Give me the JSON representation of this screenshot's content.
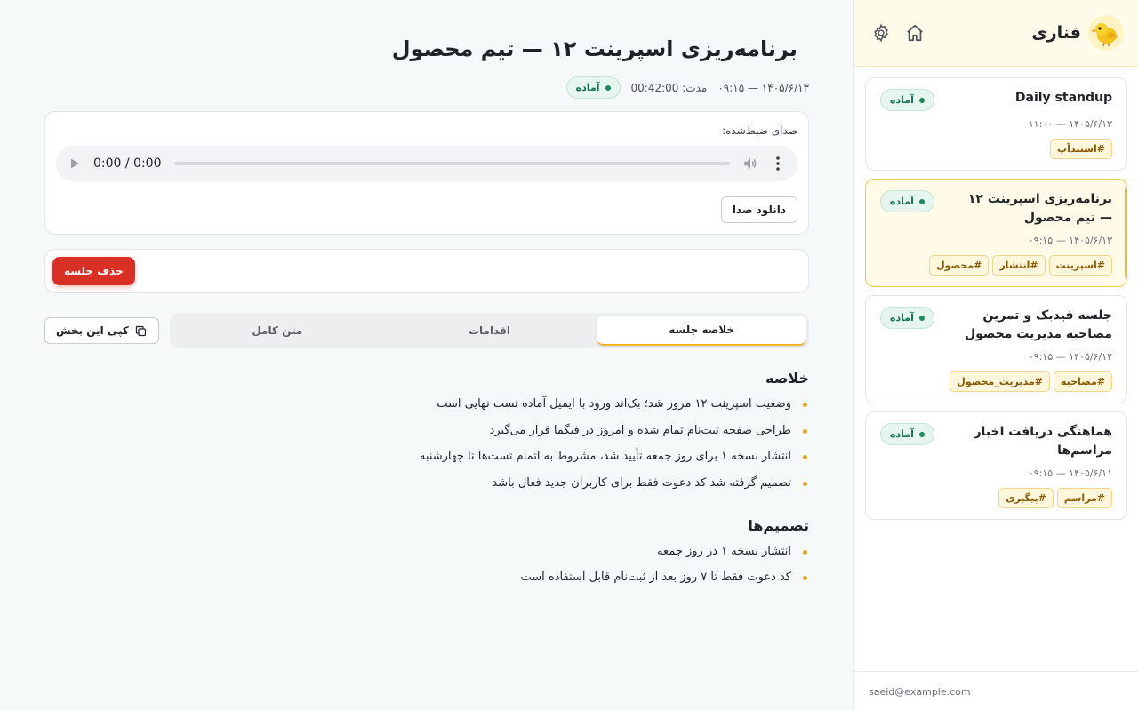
{
  "app": {
    "name": "قناری",
    "user_email": "saeid@example.com"
  },
  "colors": {
    "accent": "#f0b42a",
    "danger": "#d93025",
    "status_ready": "#1a8a5b"
  },
  "icons": {
    "logo": "canary-bird-icon",
    "home": "home-icon",
    "settings": "gear-icon",
    "copy": "copy-icon",
    "play": "play-icon",
    "volume": "volume-icon",
    "more": "more-vertical-icon"
  },
  "meetings": [
    {
      "title": "Daily standup",
      "date": "۱۴۰۵/۶/۱۳ — ۱۱:۰۰",
      "status": "آماده",
      "tags": [
        "#استندآپ"
      ],
      "active": false
    },
    {
      "title": "برنامه‌ریزی اسپرینت ۱۲ — تیم محصول",
      "date": "۱۴۰۵/۶/۱۳ — ۰۹:۱۵",
      "status": "آماده",
      "tags": [
        "#اسپرینت",
        "#انتشار",
        "#محصول"
      ],
      "active": true
    },
    {
      "title": "جلسه فیدبک و تمرین مصاحبه مدیریت محصول",
      "date": "۱۴۰۵/۶/۱۲ — ۰۹:۱۵",
      "status": "آماده",
      "tags": [
        "#مصاحبه",
        "#مدیریت_محصول"
      ],
      "active": false
    },
    {
      "title": "هماهنگی دریافت اخبار مراسم‌ها",
      "date": "۱۴۰۵/۶/۱۱ — ۰۹:۱۵",
      "status": "آماده",
      "tags": [
        "#مراسم",
        "#پیگیری"
      ],
      "active": false
    }
  ],
  "detail": {
    "title": "برنامه‌ریزی اسپرینت ۱۲ — تیم محصول",
    "datetime": "۱۴۰۵/۶/۱۳ — ۰۹:۱۵",
    "duration": "مدت: 00:42:00",
    "status": "آماده",
    "audio": {
      "label": "صدای ضبط‌شده:",
      "time": "0:00 / 0:00",
      "download_label": "دانلود صدا"
    },
    "delete_label": "حذف جلسه",
    "tabs": [
      {
        "label": "خلاصه جلسه",
        "active": true
      },
      {
        "label": "اقدامات",
        "active": false
      },
      {
        "label": "متن کامل",
        "active": false
      }
    ],
    "copy_label": "کپی این بخش",
    "summary": {
      "heading": "خلاصه",
      "items": [
        "وضعیت اسپرینت ۱۲ مرور شد؛ بک‌اند ورود با ایمیل آماده تست نهایی است",
        "طراحی صفحه ثبت‌نام تمام شده و امروز در فیگما قرار می‌گیرد",
        "انتشار نسخه ۱ برای روز جمعه تأیید شد، مشروط به اتمام تست‌ها تا چهارشنبه",
        "تصمیم گرفته شد کد دعوت فقط برای کاربران جدید فعال باشد"
      ]
    },
    "decisions": {
      "heading": "تصمیم‌ها",
      "items": [
        "انتشار نسخه ۱ در روز جمعه",
        "کد دعوت فقط تا ۷ روز بعد از ثبت‌نام قابل استفاده است"
      ]
    }
  }
}
